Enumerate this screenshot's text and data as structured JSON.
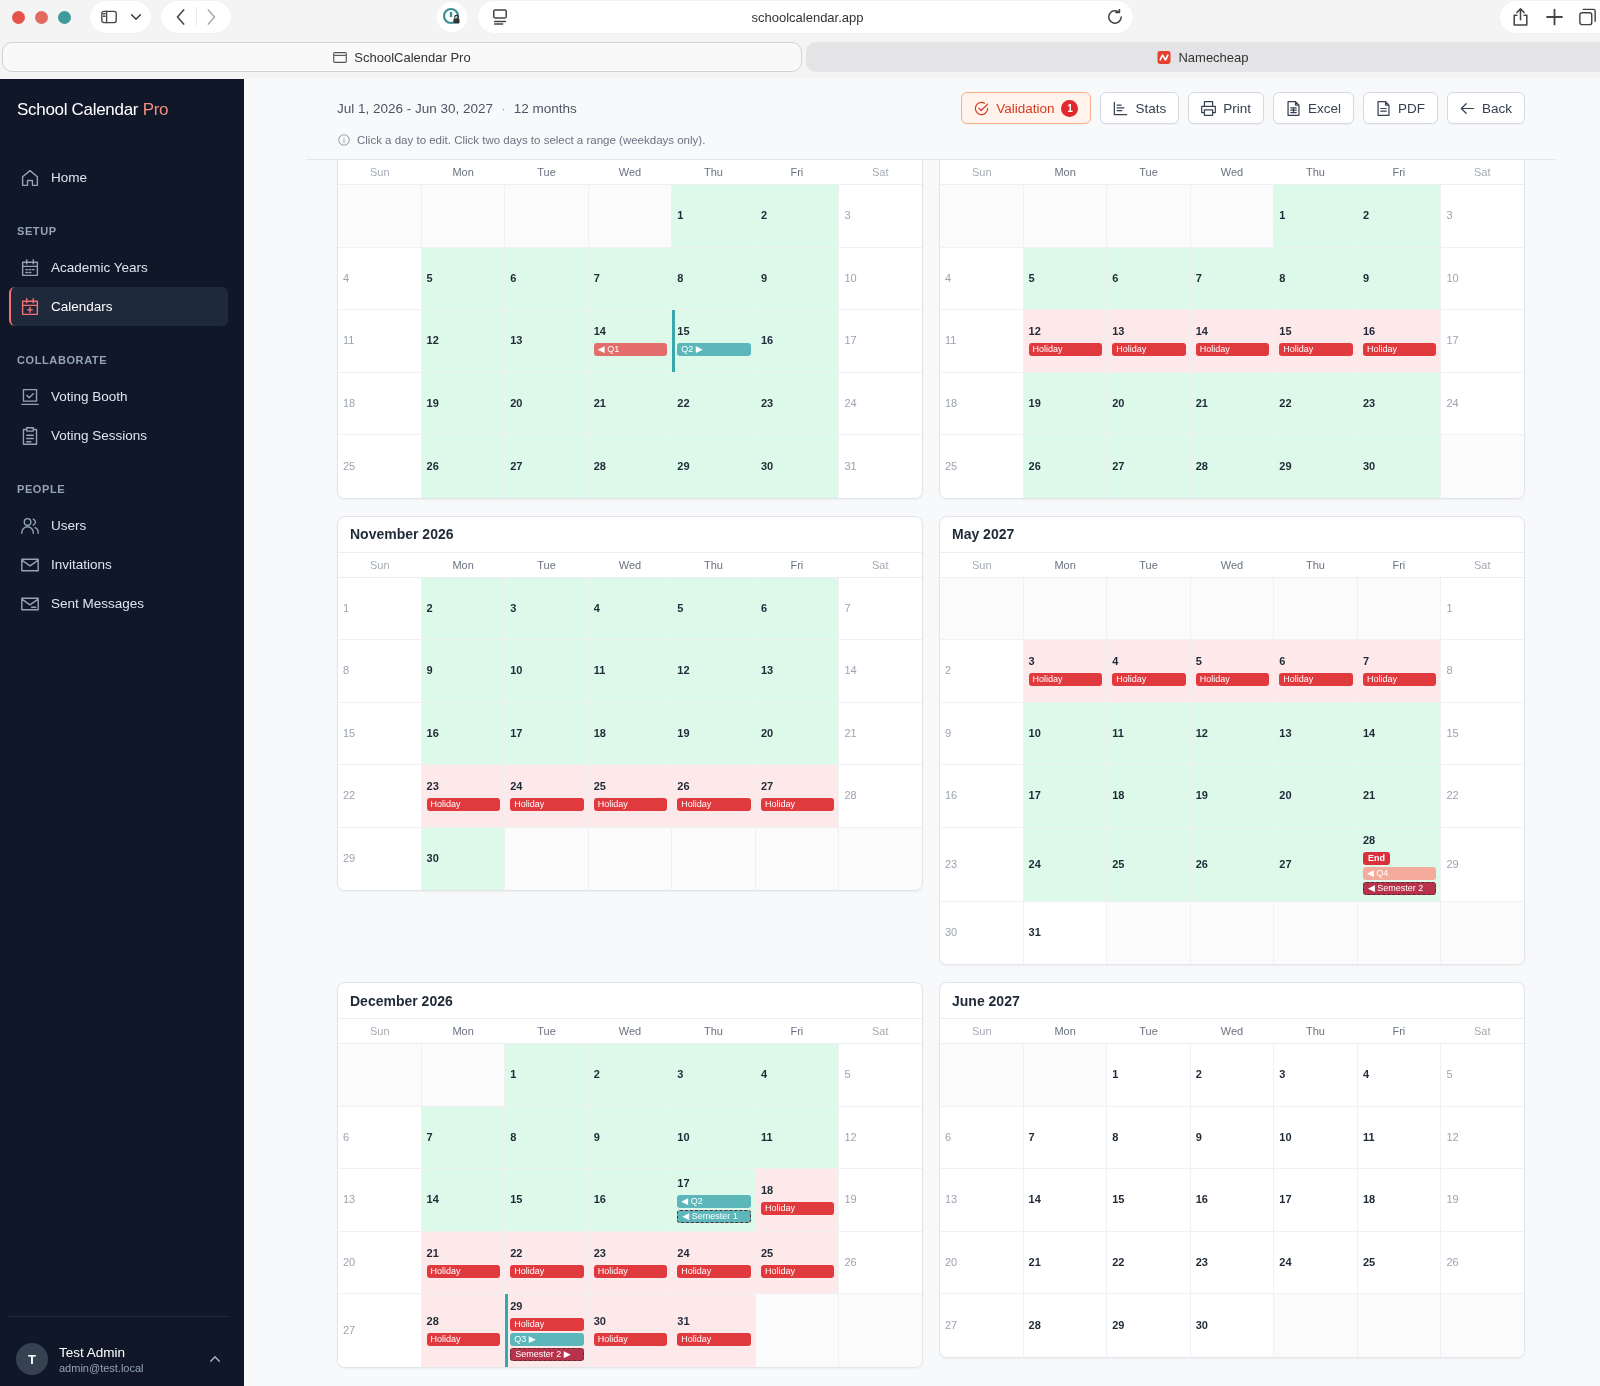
{
  "browser": {
    "url": "schoolcalendar.app",
    "tabs": [
      {
        "title": "SchoolCalendar Pro",
        "kind": "page",
        "selected": true
      },
      {
        "title": "Namecheap",
        "kind": "logo",
        "selected": false
      }
    ]
  },
  "sidebar": {
    "brand": "School Calendar",
    "brand_suffix": "Pro",
    "groups": [
      {
        "items": [
          {
            "label": "Home",
            "kind": "home",
            "selected": false
          }
        ]
      },
      {
        "heading": "SETUP",
        "items": [
          {
            "label": "Academic Years",
            "kind": "calendar",
            "selected": false
          },
          {
            "label": "Calendars",
            "kind": "planner",
            "selected": true
          }
        ]
      },
      {
        "heading": "COLLABORATE",
        "items": [
          {
            "label": "Voting Booth",
            "kind": "ballot",
            "selected": false
          },
          {
            "label": "Voting Sessions",
            "kind": "clipboard",
            "selected": false
          }
        ]
      },
      {
        "heading": "PEOPLE",
        "items": [
          {
            "label": "Users",
            "kind": "users",
            "selected": false
          },
          {
            "label": "Invitations",
            "kind": "mail",
            "selected": false
          },
          {
            "label": "Sent Messages",
            "kind": "outbox",
            "selected": false
          }
        ]
      }
    ],
    "user": {
      "initial": "T",
      "name": "Test Admin",
      "email": "admin@test.local"
    }
  },
  "header": {
    "range": "Jul 1, 2026 - Jun 30, 2027",
    "separator": "·",
    "duration": "12 months",
    "hint": "Click a day to edit. Click two days to select a range (weekdays only).",
    "buttons": [
      {
        "label": "Validation",
        "kind": "validation",
        "alert": true,
        "badge": "1"
      },
      {
        "label": "Stats",
        "kind": "stats"
      },
      {
        "label": "Print",
        "kind": "print"
      },
      {
        "label": "Excel",
        "kind": "excel"
      },
      {
        "label": "PDF",
        "kind": "pdf"
      },
      {
        "label": "Back",
        "kind": "back"
      }
    ]
  },
  "months": [
    {
      "weekdays": [
        "Sun",
        "Mon",
        "Tue",
        "Wed",
        "Thu",
        "Fri",
        "Sat"
      ],
      "weeks": [
        [
          {
            "kind": "blank"
          },
          {
            "kind": "blank"
          },
          {
            "kind": "blank"
          },
          {
            "kind": "blank"
          },
          {
            "day": "1",
            "kind": "school"
          },
          {
            "day": "2",
            "kind": "school"
          },
          {
            "day": "3",
            "kind": "weekend"
          }
        ],
        [
          {
            "day": "4",
            "kind": "weekend"
          },
          {
            "day": "5",
            "kind": "school"
          },
          {
            "day": "6",
            "kind": "school"
          },
          {
            "day": "7",
            "kind": "school"
          },
          {
            "day": "8",
            "kind": "school"
          },
          {
            "day": "9",
            "kind": "school"
          },
          {
            "day": "10",
            "kind": "weekend"
          }
        ],
        [
          {
            "day": "11",
            "kind": "weekend"
          },
          {
            "day": "12",
            "kind": "school"
          },
          {
            "day": "13",
            "kind": "school"
          },
          {
            "day": "14",
            "kind": "school",
            "events": [
              {
                "label": "◀ Q1",
                "kind": "quarter",
                "color": "#e36d6a"
              }
            ]
          },
          {
            "day": "15",
            "kind": "school",
            "term_start": true,
            "events": [
              {
                "label": "Q2 ▶",
                "kind": "quarter",
                "color": "#5cb7ba"
              }
            ]
          },
          {
            "day": "16",
            "kind": "school"
          },
          {
            "day": "17",
            "kind": "weekend"
          }
        ],
        [
          {
            "day": "18",
            "kind": "weekend"
          },
          {
            "day": "19",
            "kind": "school"
          },
          {
            "day": "20",
            "kind": "school"
          },
          {
            "day": "21",
            "kind": "school"
          },
          {
            "day": "22",
            "kind": "school"
          },
          {
            "day": "23",
            "kind": "school"
          },
          {
            "day": "24",
            "kind": "weekend"
          }
        ],
        [
          {
            "day": "25",
            "kind": "weekend"
          },
          {
            "day": "26",
            "kind": "school"
          },
          {
            "day": "27",
            "kind": "school"
          },
          {
            "day": "28",
            "kind": "school"
          },
          {
            "day": "29",
            "kind": "school"
          },
          {
            "day": "30",
            "kind": "school"
          },
          {
            "day": "31",
            "kind": "weekend"
          }
        ]
      ]
    },
    {
      "weekdays": [
        "Sun",
        "Mon",
        "Tue",
        "Wed",
        "Thu",
        "Fri",
        "Sat"
      ],
      "weeks": [
        [
          {
            "kind": "blank"
          },
          {
            "kind": "blank"
          },
          {
            "kind": "blank"
          },
          {
            "kind": "blank"
          },
          {
            "day": "1",
            "kind": "school"
          },
          {
            "day": "2",
            "kind": "school"
          },
          {
            "day": "3",
            "kind": "weekend"
          }
        ],
        [
          {
            "day": "4",
            "kind": "weekend"
          },
          {
            "day": "5",
            "kind": "school"
          },
          {
            "day": "6",
            "kind": "school"
          },
          {
            "day": "7",
            "kind": "school"
          },
          {
            "day": "8",
            "kind": "school"
          },
          {
            "day": "9",
            "kind": "school"
          },
          {
            "day": "10",
            "kind": "weekend"
          }
        ],
        [
          {
            "day": "11",
            "kind": "weekend"
          },
          {
            "day": "12",
            "kind": "holiday",
            "events": [
              {
                "label": "Holiday",
                "kind": "holiday",
                "color": "#e0393e"
              }
            ]
          },
          {
            "day": "13",
            "kind": "holiday",
            "events": [
              {
                "label": "Holiday",
                "kind": "holiday",
                "color": "#e0393e"
              }
            ]
          },
          {
            "day": "14",
            "kind": "holiday",
            "events": [
              {
                "label": "Holiday",
                "kind": "holiday",
                "color": "#e0393e"
              }
            ]
          },
          {
            "day": "15",
            "kind": "holiday",
            "events": [
              {
                "label": "Holiday",
                "kind": "holiday",
                "color": "#e0393e"
              }
            ]
          },
          {
            "day": "16",
            "kind": "holiday",
            "events": [
              {
                "label": "Holiday",
                "kind": "holiday",
                "color": "#e0393e"
              }
            ]
          },
          {
            "day": "17",
            "kind": "weekend"
          }
        ],
        [
          {
            "day": "18",
            "kind": "weekend"
          },
          {
            "day": "19",
            "kind": "school"
          },
          {
            "day": "20",
            "kind": "school"
          },
          {
            "day": "21",
            "kind": "school"
          },
          {
            "day": "22",
            "kind": "school"
          },
          {
            "day": "23",
            "kind": "school"
          },
          {
            "day": "24",
            "kind": "weekend"
          }
        ],
        [
          {
            "day": "25",
            "kind": "weekend"
          },
          {
            "day": "26",
            "kind": "school"
          },
          {
            "day": "27",
            "kind": "school"
          },
          {
            "day": "28",
            "kind": "school"
          },
          {
            "day": "29",
            "kind": "school"
          },
          {
            "day": "30",
            "kind": "school"
          },
          {
            "kind": "blank"
          }
        ]
      ]
    },
    {
      "title": "November 2026",
      "weekdays": [
        "Sun",
        "Mon",
        "Tue",
        "Wed",
        "Thu",
        "Fri",
        "Sat"
      ],
      "weeks": [
        [
          {
            "day": "1",
            "kind": "weekend"
          },
          {
            "day": "2",
            "kind": "school"
          },
          {
            "day": "3",
            "kind": "school"
          },
          {
            "day": "4",
            "kind": "school"
          },
          {
            "day": "5",
            "kind": "school"
          },
          {
            "day": "6",
            "kind": "school"
          },
          {
            "day": "7",
            "kind": "weekend"
          }
        ],
        [
          {
            "day": "8",
            "kind": "weekend"
          },
          {
            "day": "9",
            "kind": "school"
          },
          {
            "day": "10",
            "kind": "school"
          },
          {
            "day": "11",
            "kind": "school"
          },
          {
            "day": "12",
            "kind": "school"
          },
          {
            "day": "13",
            "kind": "school"
          },
          {
            "day": "14",
            "kind": "weekend"
          }
        ],
        [
          {
            "day": "15",
            "kind": "weekend"
          },
          {
            "day": "16",
            "kind": "school"
          },
          {
            "day": "17",
            "kind": "school"
          },
          {
            "day": "18",
            "kind": "school"
          },
          {
            "day": "19",
            "kind": "school"
          },
          {
            "day": "20",
            "kind": "school"
          },
          {
            "day": "21",
            "kind": "weekend"
          }
        ],
        [
          {
            "day": "22",
            "kind": "weekend"
          },
          {
            "day": "23",
            "kind": "holiday",
            "events": [
              {
                "label": "Holiday",
                "kind": "holiday",
                "color": "#e0393e"
              }
            ]
          },
          {
            "day": "24",
            "kind": "holiday",
            "events": [
              {
                "label": "Holiday",
                "kind": "holiday",
                "color": "#e0393e"
              }
            ]
          },
          {
            "day": "25",
            "kind": "holiday",
            "events": [
              {
                "label": "Holiday",
                "kind": "holiday",
                "color": "#e0393e"
              }
            ]
          },
          {
            "day": "26",
            "kind": "holiday",
            "events": [
              {
                "label": "Holiday",
                "kind": "holiday",
                "color": "#e0393e"
              }
            ]
          },
          {
            "day": "27",
            "kind": "holiday",
            "events": [
              {
                "label": "Holiday",
                "kind": "holiday",
                "color": "#e0393e"
              }
            ]
          },
          {
            "day": "28",
            "kind": "weekend"
          }
        ],
        [
          {
            "day": "29",
            "kind": "weekend"
          },
          {
            "day": "30",
            "kind": "school"
          },
          {
            "kind": "blank"
          },
          {
            "kind": "blank"
          },
          {
            "kind": "blank"
          },
          {
            "kind": "blank"
          },
          {
            "kind": "blank"
          }
        ]
      ]
    },
    {
      "title": "May 2027",
      "weekdays": [
        "Sun",
        "Mon",
        "Tue",
        "Wed",
        "Thu",
        "Fri",
        "Sat"
      ],
      "weeks": [
        [
          {
            "kind": "blank"
          },
          {
            "kind": "blank"
          },
          {
            "kind": "blank"
          },
          {
            "kind": "blank"
          },
          {
            "kind": "blank"
          },
          {
            "kind": "blank"
          },
          {
            "day": "1",
            "kind": "weekend"
          }
        ],
        [
          {
            "day": "2",
            "kind": "weekend"
          },
          {
            "day": "3",
            "kind": "holiday",
            "events": [
              {
                "label": "Holiday",
                "kind": "holiday",
                "color": "#e0393e"
              }
            ]
          },
          {
            "day": "4",
            "kind": "holiday",
            "events": [
              {
                "label": "Holiday",
                "kind": "holiday",
                "color": "#e0393e"
              }
            ]
          },
          {
            "day": "5",
            "kind": "holiday",
            "events": [
              {
                "label": "Holiday",
                "kind": "holiday",
                "color": "#e0393e"
              }
            ]
          },
          {
            "day": "6",
            "kind": "holiday",
            "events": [
              {
                "label": "Holiday",
                "kind": "holiday",
                "color": "#e0393e"
              }
            ]
          },
          {
            "day": "7",
            "kind": "holiday",
            "events": [
              {
                "label": "Holiday",
                "kind": "holiday",
                "color": "#e0393e"
              }
            ]
          },
          {
            "day": "8",
            "kind": "weekend"
          }
        ],
        [
          {
            "day": "9",
            "kind": "weekend"
          },
          {
            "day": "10",
            "kind": "school"
          },
          {
            "day": "11",
            "kind": "school"
          },
          {
            "day": "12",
            "kind": "school"
          },
          {
            "day": "13",
            "kind": "school"
          },
          {
            "day": "14",
            "kind": "school"
          },
          {
            "day": "15",
            "kind": "weekend"
          }
        ],
        [
          {
            "day": "16",
            "kind": "weekend"
          },
          {
            "day": "17",
            "kind": "school"
          },
          {
            "day": "18",
            "kind": "school"
          },
          {
            "day": "19",
            "kind": "school"
          },
          {
            "day": "20",
            "kind": "school"
          },
          {
            "day": "21",
            "kind": "school"
          },
          {
            "day": "22",
            "kind": "weekend"
          }
        ],
        [
          {
            "day": "23",
            "kind": "weekend"
          },
          {
            "day": "24",
            "kind": "school"
          },
          {
            "day": "25",
            "kind": "school"
          },
          {
            "day": "26",
            "kind": "school"
          },
          {
            "day": "27",
            "kind": "school"
          },
          {
            "day": "28",
            "kind": "school",
            "events": [
              {
                "label": "End",
                "kind": "end",
                "color": "#dc2f3c"
              },
              {
                "label": "◀ Q4",
                "kind": "quarter",
                "color": "#f5ab9c"
              },
              {
                "label": "◀ Semester 2",
                "kind": "semester",
                "color": "#b7334b"
              }
            ]
          },
          {
            "day": "29",
            "kind": "weekend"
          }
        ],
        [
          {
            "day": "30",
            "kind": "weekend"
          },
          {
            "day": "31",
            "kind": "plain"
          },
          {
            "kind": "blank"
          },
          {
            "kind": "blank"
          },
          {
            "kind": "blank"
          },
          {
            "kind": "blank"
          },
          {
            "kind": "blank"
          }
        ]
      ]
    },
    {
      "title": "December 2026",
      "weekdays": [
        "Sun",
        "Mon",
        "Tue",
        "Wed",
        "Thu",
        "Fri",
        "Sat"
      ],
      "weeks": [
        [
          {
            "kind": "blank"
          },
          {
            "kind": "blank"
          },
          {
            "day": "1",
            "kind": "school"
          },
          {
            "day": "2",
            "kind": "school"
          },
          {
            "day": "3",
            "kind": "school"
          },
          {
            "day": "4",
            "kind": "school"
          },
          {
            "day": "5",
            "kind": "weekend"
          }
        ],
        [
          {
            "day": "6",
            "kind": "weekend"
          },
          {
            "day": "7",
            "kind": "school"
          },
          {
            "day": "8",
            "kind": "school"
          },
          {
            "day": "9",
            "kind": "school"
          },
          {
            "day": "10",
            "kind": "school"
          },
          {
            "day": "11",
            "kind": "school"
          },
          {
            "day": "12",
            "kind": "weekend"
          }
        ],
        [
          {
            "day": "13",
            "kind": "weekend"
          },
          {
            "day": "14",
            "kind": "school"
          },
          {
            "day": "15",
            "kind": "school"
          },
          {
            "day": "16",
            "kind": "school"
          },
          {
            "day": "17",
            "kind": "school",
            "events": [
              {
                "label": "◀ Q2",
                "kind": "quarter",
                "color": "#5cb7ba"
              },
              {
                "label": "◀ Semester 1",
                "kind": "semester",
                "color": "#5cb7ba"
              }
            ]
          },
          {
            "day": "18",
            "kind": "holiday",
            "events": [
              {
                "label": "Holiday",
                "kind": "holiday",
                "color": "#e0393e"
              }
            ]
          },
          {
            "day": "19",
            "kind": "weekend"
          }
        ],
        [
          {
            "day": "20",
            "kind": "weekend"
          },
          {
            "day": "21",
            "kind": "holiday",
            "events": [
              {
                "label": "Holiday",
                "kind": "holiday",
                "color": "#e0393e"
              }
            ]
          },
          {
            "day": "22",
            "kind": "holiday",
            "events": [
              {
                "label": "Holiday",
                "kind": "holiday",
                "color": "#e0393e"
              }
            ]
          },
          {
            "day": "23",
            "kind": "holiday",
            "events": [
              {
                "label": "Holiday",
                "kind": "holiday",
                "color": "#e0393e"
              }
            ]
          },
          {
            "day": "24",
            "kind": "holiday",
            "events": [
              {
                "label": "Holiday",
                "kind": "holiday",
                "color": "#e0393e"
              }
            ]
          },
          {
            "day": "25",
            "kind": "holiday",
            "events": [
              {
                "label": "Holiday",
                "kind": "holiday",
                "color": "#e0393e"
              }
            ]
          },
          {
            "day": "26",
            "kind": "weekend"
          }
        ],
        [
          {
            "day": "27",
            "kind": "weekend"
          },
          {
            "day": "28",
            "kind": "holiday",
            "events": [
              {
                "label": "Holiday",
                "kind": "holiday",
                "color": "#e0393e"
              }
            ]
          },
          {
            "day": "29",
            "kind": "holiday",
            "term_start": true,
            "events": [
              {
                "label": "Holiday",
                "kind": "holiday",
                "color": "#e0393e"
              },
              {
                "label": "Q3 ▶",
                "kind": "quarter",
                "color": "#5cb7ba"
              },
              {
                "label": "Semester 2 ▶",
                "kind": "semester",
                "color": "#b7334b"
              }
            ]
          },
          {
            "day": "30",
            "kind": "holiday",
            "events": [
              {
                "label": "Holiday",
                "kind": "holiday",
                "color": "#e0393e"
              }
            ]
          },
          {
            "day": "31",
            "kind": "holiday",
            "events": [
              {
                "label": "Holiday",
                "kind": "holiday",
                "color": "#e0393e"
              }
            ]
          },
          {
            "kind": "blank"
          },
          {
            "kind": "blank"
          }
        ]
      ]
    },
    {
      "title": "June 2027",
      "weekdays": [
        "Sun",
        "Mon",
        "Tue",
        "Wed",
        "Thu",
        "Fri",
        "Sat"
      ],
      "weeks": [
        [
          {
            "kind": "blank"
          },
          {
            "kind": "blank"
          },
          {
            "day": "1",
            "kind": "plain"
          },
          {
            "day": "2",
            "kind": "plain"
          },
          {
            "day": "3",
            "kind": "plain"
          },
          {
            "day": "4",
            "kind": "plain"
          },
          {
            "day": "5",
            "kind": "weekend"
          }
        ],
        [
          {
            "day": "6",
            "kind": "weekend"
          },
          {
            "day": "7",
            "kind": "plain"
          },
          {
            "day": "8",
            "kind": "plain"
          },
          {
            "day": "9",
            "kind": "plain"
          },
          {
            "day": "10",
            "kind": "plain"
          },
          {
            "day": "11",
            "kind": "plain"
          },
          {
            "day": "12",
            "kind": "weekend"
          }
        ],
        [
          {
            "day": "13",
            "kind": "weekend"
          },
          {
            "day": "14",
            "kind": "plain"
          },
          {
            "day": "15",
            "kind": "plain"
          },
          {
            "day": "16",
            "kind": "plain"
          },
          {
            "day": "17",
            "kind": "plain"
          },
          {
            "day": "18",
            "kind": "plain"
          },
          {
            "day": "19",
            "kind": "weekend"
          }
        ],
        [
          {
            "day": "20",
            "kind": "weekend"
          },
          {
            "day": "21",
            "kind": "plain"
          },
          {
            "day": "22",
            "kind": "plain"
          },
          {
            "day": "23",
            "kind": "plain"
          },
          {
            "day": "24",
            "kind": "plain"
          },
          {
            "day": "25",
            "kind": "plain"
          },
          {
            "day": "26",
            "kind": "weekend"
          }
        ],
        [
          {
            "day": "27",
            "kind": "weekend"
          },
          {
            "day": "28",
            "kind": "plain"
          },
          {
            "day": "29",
            "kind": "plain"
          },
          {
            "day": "30",
            "kind": "plain"
          },
          {
            "kind": "blank"
          },
          {
            "kind": "blank"
          },
          {
            "kind": "blank"
          }
        ]
      ]
    }
  ]
}
